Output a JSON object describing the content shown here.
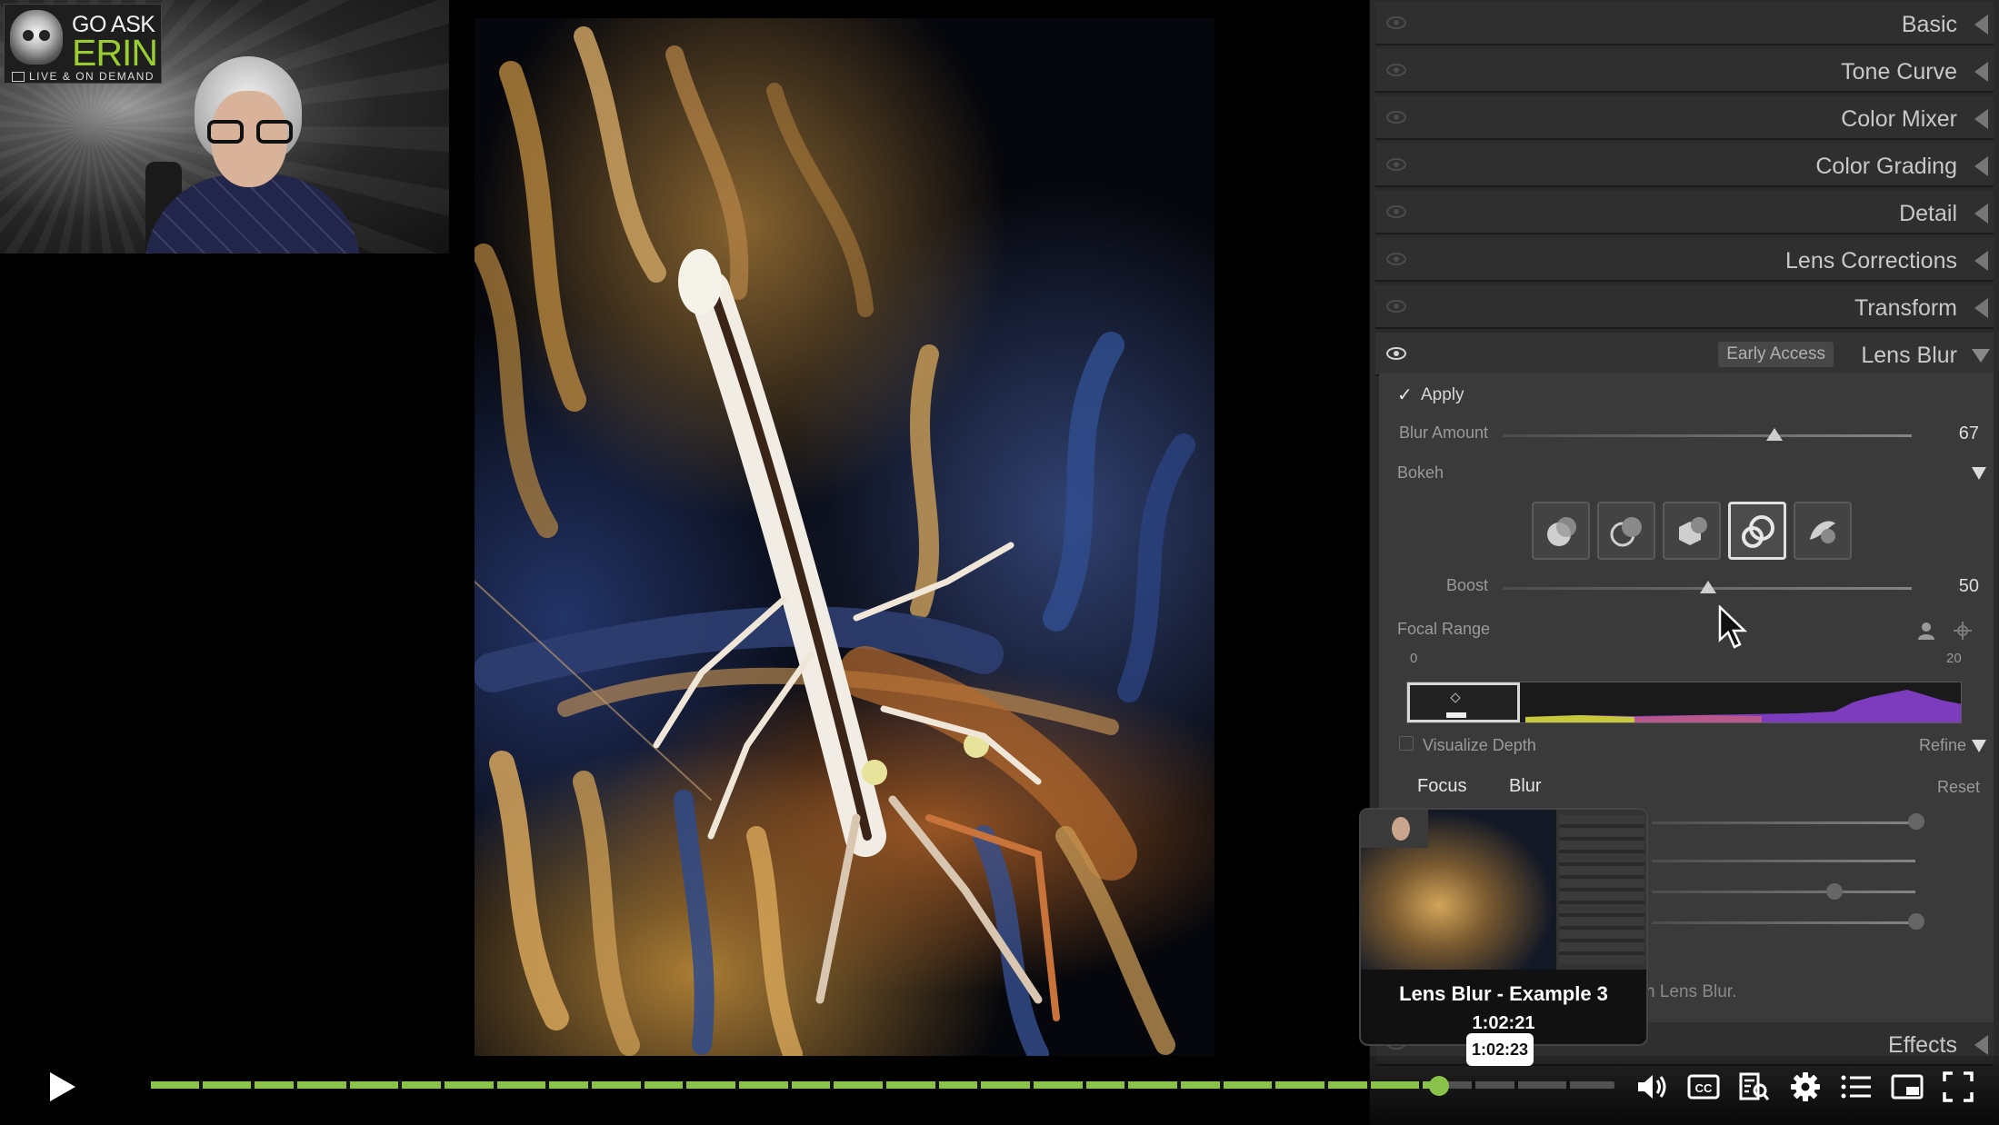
{
  "webcam": {
    "logo_line1": "GO ASK",
    "logo_line2": "ERIN",
    "logo_line3": "LIVE & ON DEMAND"
  },
  "panel": {
    "sections": [
      {
        "label": "Basic",
        "open": false
      },
      {
        "label": "Tone Curve",
        "open": false
      },
      {
        "label": "Color Mixer",
        "open": false
      },
      {
        "label": "Color Grading",
        "open": false
      },
      {
        "label": "Detail",
        "open": false
      },
      {
        "label": "Lens Corrections",
        "open": false
      },
      {
        "label": "Transform",
        "open": false
      },
      {
        "label": "Lens Blur",
        "open": true,
        "badge": "Early Access"
      }
    ],
    "effects_label": "Effects",
    "lens_blur": {
      "apply_label": "Apply",
      "apply_checked": true,
      "blur_amount_label": "Blur Amount",
      "blur_amount_value": "67",
      "bokeh_label": "Bokeh",
      "bokeh_selected_index": 3,
      "bokeh_icons": [
        "circle-bokeh-icon",
        "bubble-bokeh-icon",
        "blade-bokeh-icon",
        "ring-bokeh-icon",
        "cat-eye-bokeh-icon"
      ],
      "boost_label": "Boost",
      "boost_value": "50",
      "focal_range_label": "Focal Range",
      "focal_range_min": "0",
      "focal_range_max": "20",
      "visualize_depth_label": "Visualize Depth",
      "refine_label": "Refine",
      "focus_label": "Focus",
      "blur_label": "Blur",
      "reset_label": "Reset",
      "partial_hint": "n Lens Blur."
    }
  },
  "preview": {
    "title": "Lens Blur - Example 3",
    "time": "1:02:21"
  },
  "player": {
    "tooltip_time": "1:02:23",
    "progress": 0.88,
    "colors": {
      "accent": "#8bc34a"
    }
  }
}
